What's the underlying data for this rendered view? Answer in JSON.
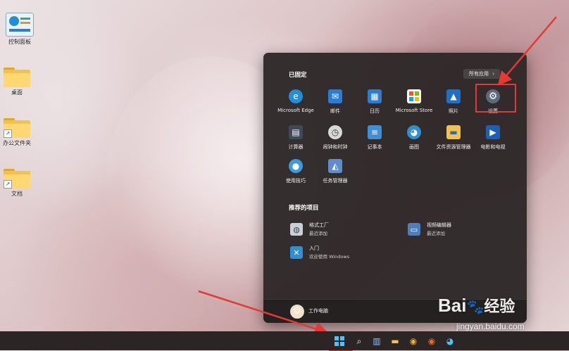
{
  "desktop": {
    "icons": [
      {
        "label": "控制面板",
        "type": "control-panel"
      },
      {
        "label": "桌面",
        "type": "folder"
      },
      {
        "label": "办公文件夹",
        "type": "folder-shortcut"
      },
      {
        "label": "文档",
        "type": "folder-shortcut"
      }
    ]
  },
  "start_menu": {
    "pinned_title": "已固定",
    "all_apps_label": "所有应用",
    "all_apps_chevron": "›",
    "pinned_apps": [
      {
        "label": "Microsoft Edge",
        "icon": "edge-icon",
        "glyph": "e",
        "color": "#1f8fd6"
      },
      {
        "label": "邮件",
        "icon": "mail-icon",
        "glyph": "✉",
        "color": "#2b7cd3"
      },
      {
        "label": "日历",
        "icon": "calendar-icon",
        "glyph": "▦",
        "color": "#2b7cd3"
      },
      {
        "label": "Microsoft Store",
        "icon": "store-icon",
        "glyph": "⊞",
        "color": "#3a3a3a"
      },
      {
        "label": "照片",
        "icon": "photos-icon",
        "glyph": "▲",
        "color": "#1e6fc8"
      },
      {
        "label": "设置",
        "icon": "gear-icon",
        "glyph": "⚙",
        "color": "#5a6a7a"
      },
      {
        "label": "计算器",
        "icon": "calculator-icon",
        "glyph": "▤",
        "color": "#3d4a5a"
      },
      {
        "label": "闹钟和时钟",
        "icon": "clock-icon",
        "glyph": "◷",
        "color": "#d8d8d8"
      },
      {
        "label": "记事本",
        "icon": "notepad-icon",
        "glyph": "≡",
        "color": "#3f8fd6"
      },
      {
        "label": "画图",
        "icon": "paint-icon",
        "glyph": "◕",
        "color": "#2f8fd0"
      },
      {
        "label": "文件资源管理器",
        "icon": "file-explorer-icon",
        "glyph": "▬",
        "color": "#f2c14e"
      },
      {
        "label": "电影和电视",
        "icon": "movies-icon",
        "glyph": "▶",
        "color": "#1e5fb4"
      },
      {
        "label": "使用技巧",
        "icon": "tips-icon",
        "glyph": "●",
        "color": "#3a9be0"
      },
      {
        "label": "任务管理器",
        "icon": "task-manager-icon",
        "glyph": "◭",
        "color": "#5c8fc8"
      }
    ],
    "recommended_title": "推荐的项目",
    "recommended": [
      {
        "title": "格式工厂",
        "subtitle": "最近添加",
        "icon": "format-factory-icon",
        "glyph": "◍",
        "color": "#c8d0d8"
      },
      {
        "title": "视频编辑器",
        "subtitle": "最近添加",
        "icon": "video-editor-icon",
        "glyph": "▭",
        "color": "#4a7fc0"
      },
      {
        "title": "入门",
        "subtitle": "欢迎使用 Windows",
        "icon": "get-started-icon",
        "glyph": "✕",
        "color": "#2f8fd6"
      }
    ],
    "user_name": "工作电脑",
    "user_avatar_glyph": "☺"
  },
  "taskbar": {
    "start_glyph": "⊞",
    "search_glyph": "⌕",
    "widgets_glyph": "▥",
    "explorer_glyph": "▬",
    "chrome_glyph": "◉",
    "chrome2_glyph": "◉",
    "paint_glyph": "◕"
  },
  "watermark": {
    "brand": "Bai",
    "brand_paw": "🐾",
    "brand_suffix": "经验",
    "url": "jingyan.baidu.com"
  },
  "colors": {
    "start_bg": "#2e2828",
    "highlight": "#e53935",
    "taskbar": "#2b2525"
  }
}
